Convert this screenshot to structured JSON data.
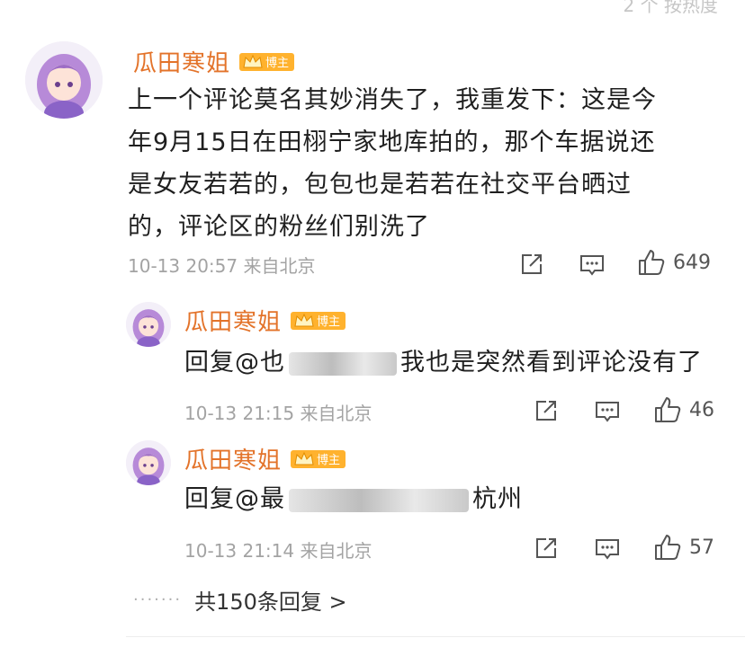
{
  "top_partial_text": "2 个 按热度",
  "main_comment": {
    "username": "瓜田寒姐",
    "badge": "博主",
    "lines": [
      "上一个评论莫名其妙消失了，我重发下：这是今",
      "年9月15日在田栩宁家地库拍的，那个车据说还",
      "是女友若若的，包包也是若若在社交平台晒过",
      "的，评论区的粉丝们别洗了"
    ],
    "time": "10-13 20:57",
    "location": "来自北京",
    "likes": "649"
  },
  "replies": [
    {
      "username": "瓜田寒姐",
      "badge": "博主",
      "prefix": "回复@也",
      "suffix": "我也是突然看到评论没有了",
      "time": "10-13 21:15",
      "location": "来自北京",
      "likes": "46"
    },
    {
      "username": "瓜田寒姐",
      "badge": "博主",
      "prefix": "回复@最",
      "suffix": "杭州",
      "time": "10-13 21:14",
      "location": "来自北京",
      "likes": "57"
    }
  ],
  "more_replies": "共150条回复 >",
  "icons": [
    "share-icon",
    "comment-icon",
    "like-icon",
    "crown-icon"
  ],
  "colors": {
    "username": "#e3732a",
    "badge": "#ffb22e",
    "meta": "#a3a3a3"
  }
}
